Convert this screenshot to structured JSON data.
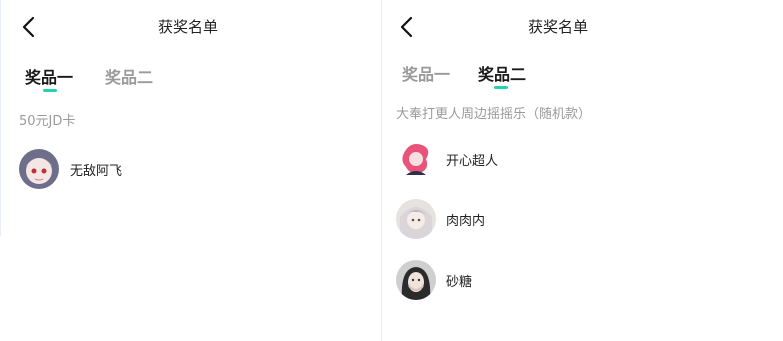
{
  "left": {
    "header": {
      "title": "获奖名单",
      "back_icon": "chevron-left-icon"
    },
    "tabs": [
      {
        "label": "奖品一",
        "active": true
      },
      {
        "label": "奖品二",
        "active": false
      }
    ],
    "prize": "50元JD卡",
    "winners": [
      {
        "name": "无敌阿飞",
        "avatar": "anime-avatar"
      }
    ]
  },
  "right": {
    "header": {
      "title": "获奖名单",
      "back_icon": "chevron-left-icon"
    },
    "tabs": [
      {
        "label": "奖品一",
        "active": false
      },
      {
        "label": "奖品二",
        "active": true
      }
    ],
    "prize": "大奉打更人周边摇摇乐（随机款）",
    "winners": [
      {
        "name": "开心超人",
        "avatar": "anime-avatar"
      },
      {
        "name": "肉肉内",
        "avatar": "anime-avatar"
      },
      {
        "name": "砂糖",
        "avatar": "photo-avatar"
      }
    ]
  },
  "colors": {
    "accent": "#22d3b0",
    "text": "#222222",
    "muted": "#9a9a9a"
  }
}
